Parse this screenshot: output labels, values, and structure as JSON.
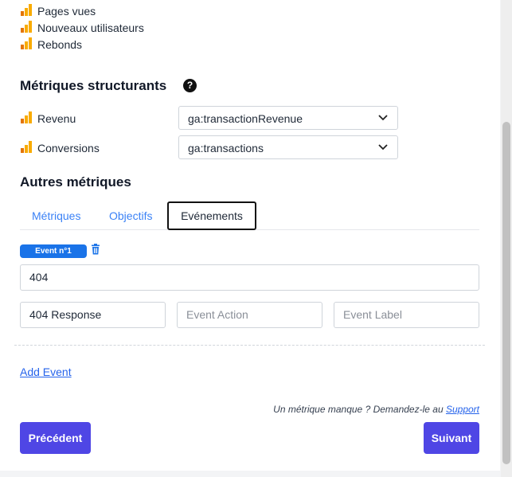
{
  "top_metrics": [
    {
      "label": "Pages vues"
    },
    {
      "label": "Nouveaux utilisateurs"
    },
    {
      "label": "Rebonds"
    }
  ],
  "structuring": {
    "title": "Métriques structurants",
    "help_glyph": "?",
    "rows": [
      {
        "label": "Revenu",
        "selected": "ga:transactionRevenue"
      },
      {
        "label": "Conversions",
        "selected": "ga:transactions"
      }
    ]
  },
  "other": {
    "title": "Autres métriques",
    "tabs": [
      {
        "label": "Métriques",
        "active": false
      },
      {
        "label": "Objectifs",
        "active": false
      },
      {
        "label": "Evénements",
        "active": true
      }
    ]
  },
  "event": {
    "badge": "Event n°1",
    "name_value": "404",
    "category_value": "404 Response",
    "action_placeholder": "Event Action",
    "label_placeholder": "Event Label"
  },
  "add_event_label": "Add Event",
  "missing_text": "Un métrique manque ? Demandez-le au ",
  "support_link": "Support",
  "buttons": {
    "prev": "Précédent",
    "next": "Suivant"
  },
  "colors": {
    "accent": "#4f46e5",
    "badge": "#1a73e8",
    "link": "#2563eb",
    "ga_orange": "#f9ab00",
    "ga_dark_orange": "#e37400"
  },
  "icons": {
    "analytics": "google-analytics-icon",
    "help": "question-circle-icon",
    "select": "chevron-down-icon",
    "delete": "trash-icon"
  }
}
